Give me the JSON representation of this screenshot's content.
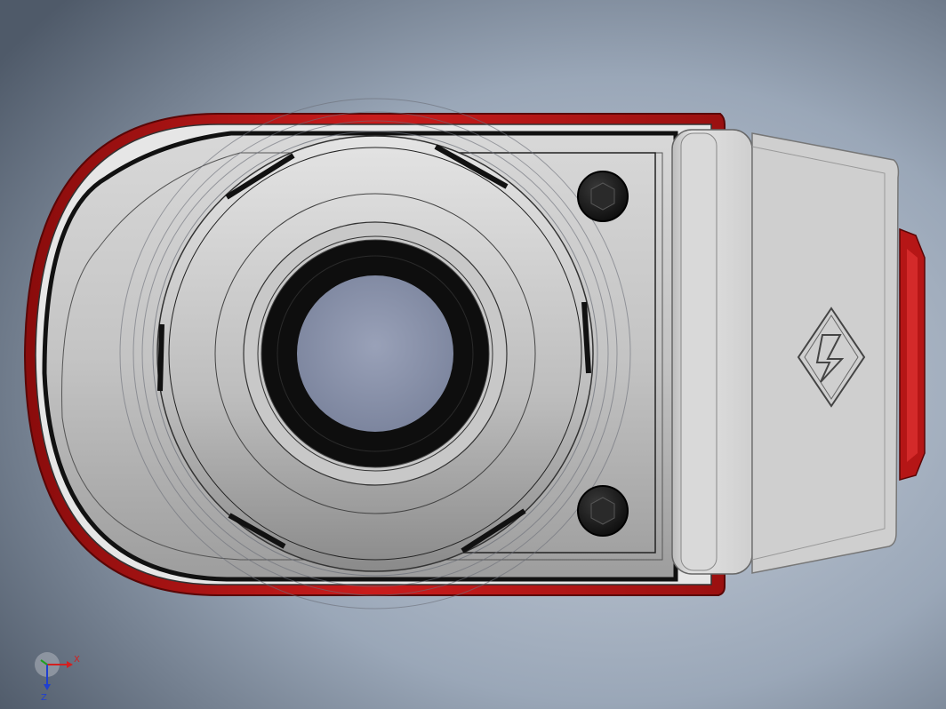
{
  "viewport": {
    "background_top": "#8a9bb0",
    "background_bottom": "#c4ccd6",
    "background_left": "#4a5564"
  },
  "colors": {
    "housing_red": "#c01818",
    "housing_red_dark": "#7a0a0a",
    "body_gray": "#c9c9c9",
    "cap_gray": "#d4d4d4",
    "edge_black": "#111111",
    "bore_blue": "#8a93ac",
    "bolt_dark": "#1a1a1a"
  },
  "triad": {
    "x_label": "X",
    "z_label": "Z",
    "x_color": "#d22020",
    "y_color": "#20a020",
    "z_color": "#2040d0"
  },
  "icons": {
    "logo": "lightning-diamond-logo-icon",
    "bolt": "hex-socket-bolt-icon"
  }
}
